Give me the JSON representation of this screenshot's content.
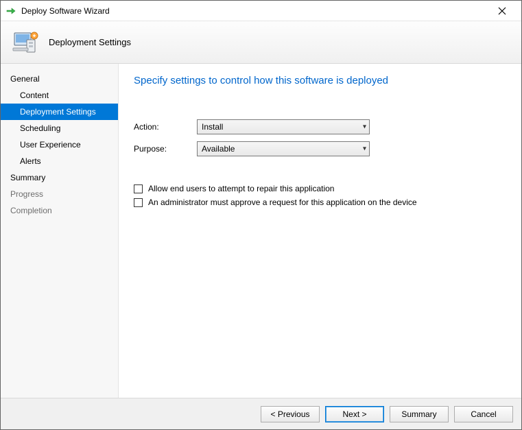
{
  "window": {
    "title": "Deploy Software Wizard"
  },
  "header": {
    "title": "Deployment Settings"
  },
  "sidebar": {
    "items": [
      {
        "label": "General",
        "level": 0,
        "selected": false,
        "muted": false
      },
      {
        "label": "Content",
        "level": 1,
        "selected": false,
        "muted": false
      },
      {
        "label": "Deployment Settings",
        "level": 1,
        "selected": true,
        "muted": false
      },
      {
        "label": "Scheduling",
        "level": 1,
        "selected": false,
        "muted": false
      },
      {
        "label": "User Experience",
        "level": 1,
        "selected": false,
        "muted": false
      },
      {
        "label": "Alerts",
        "level": 1,
        "selected": false,
        "muted": false
      },
      {
        "label": "Summary",
        "level": 0,
        "selected": false,
        "muted": false
      },
      {
        "label": "Progress",
        "level": 0,
        "selected": false,
        "muted": true
      },
      {
        "label": "Completion",
        "level": 0,
        "selected": false,
        "muted": true
      }
    ]
  },
  "content": {
    "heading": "Specify settings to control how this software is deployed",
    "fields": {
      "action": {
        "label": "Action:",
        "value": "Install"
      },
      "purpose": {
        "label": "Purpose:",
        "value": "Available"
      }
    },
    "checks": {
      "repair": {
        "label": "Allow end users to attempt to repair this application",
        "checked": false
      },
      "approve": {
        "label": "An administrator must approve a request for this application on the device",
        "checked": false
      }
    }
  },
  "footer": {
    "previous": "< Previous",
    "next": "Next >",
    "summary": "Summary",
    "cancel": "Cancel"
  }
}
